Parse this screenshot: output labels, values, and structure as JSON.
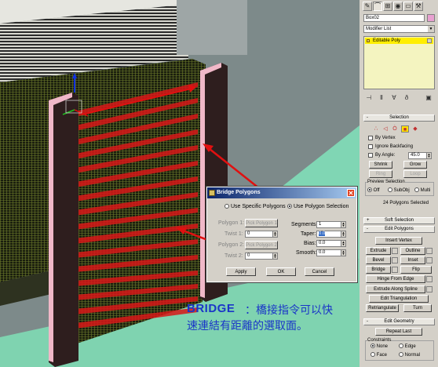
{
  "annotation": {
    "keyword": "BRIDGE",
    "line1": "：橋接指令可以快",
    "line2": "速連結有距離的選取面。"
  },
  "dialog": {
    "title": "Bridge Polygons",
    "close_icon": "close-icon",
    "mode_specific": "Use Specific Polygons",
    "mode_selection": "Use Polygon Selection",
    "polygon1_label": "Polygon 1:",
    "pick_polygon1": "Pick Polygon 1",
    "twist1_label": "Twist 1:",
    "twist1_value": "0",
    "polygon2_label": "Polygon 2:",
    "pick_polygon2": "Pick Polygon 2",
    "twist2_label": "Twist 2:",
    "twist2_value": "0",
    "segments_label": "Segments:",
    "segments_value": "1",
    "taper_label": "Taper:",
    "taper_value": "0.0",
    "bias_label": "Bias:",
    "bias_value": "0.0",
    "smooth_label": "Smooth:",
    "smooth_value": "0.0",
    "apply": "Apply",
    "ok": "OK",
    "cancel": "Cancel"
  },
  "panel": {
    "object_name": "Box02",
    "object_color": "#e8a0d0",
    "modifier_list": "Modifier List",
    "stack_item": "Editable Poly",
    "selection": {
      "header": "Selection",
      "by_vertex": "By Vertex",
      "ignore_backfacing": "Ignore Backfacing",
      "by_angle": "By Angle:",
      "angle_value": "45.0",
      "shrink": "Shrink",
      "grow": "Grow",
      "ring": "Ring",
      "loop": "Loop",
      "preview_label": "Preview Selection",
      "preview_off": "Off",
      "preview_subobj": "SubObj",
      "preview_multi": "Multi",
      "status": "24 Polygons Selected"
    },
    "soft_selection": "Soft Selection",
    "edit_polygons": {
      "header": "Edit Polygons",
      "insert_vertex": "Insert Vertex",
      "extrude": "Extrude",
      "outline": "Outline",
      "bevel": "Bevel",
      "inset": "Inset",
      "bridge": "Bridge",
      "flip": "Flip",
      "hinge": "Hinge From Edge",
      "extrude_spline": "Extrude Along Spline",
      "edit_triangulation": "Edit Triangulation",
      "retriangulate": "Retriangulate",
      "turn": "Turn"
    },
    "edit_geometry": {
      "header": "Edit Geometry",
      "repeat_last": "Repeat Last",
      "constraints": "Constraints",
      "none": "None",
      "edge": "Edge",
      "face": "Face",
      "normal": "Normal"
    }
  }
}
